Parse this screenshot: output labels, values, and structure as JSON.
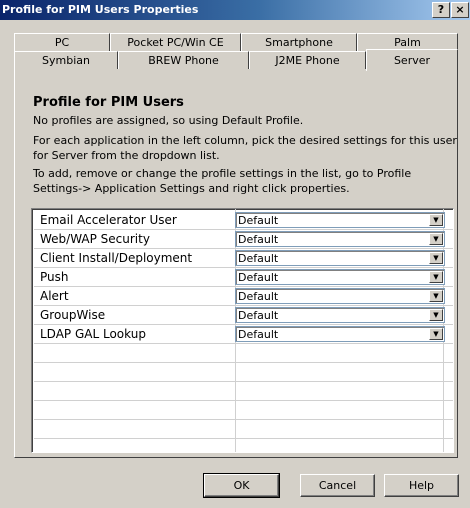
{
  "window": {
    "title": "Profile for PIM Users Properties",
    "help_button": "?",
    "close_button": "×"
  },
  "tabs": {
    "row_back": [
      "PC",
      "Pocket PC/Win CE",
      "Smartphone",
      "Palm"
    ],
    "row_front": [
      "Symbian",
      "BREW Phone",
      "J2ME Phone",
      "Server"
    ],
    "active": "Server"
  },
  "content": {
    "heading": "Profile for PIM Users",
    "line1": "No profiles are assigned, so using Default Profile.",
    "line2": "For each application in the left column, pick the desired settings for this user for Server from the dropdown list.",
    "line3": "To add, remove or change the profile settings in the list, go to Profile Settings-> Application Settings and right click properties."
  },
  "applications": [
    {
      "name": "Email Accelerator User",
      "value": "Default"
    },
    {
      "name": "Web/WAP Security",
      "value": "Default"
    },
    {
      "name": "Client Install/Deployment",
      "value": "Default"
    },
    {
      "name": "Push",
      "value": "Default"
    },
    {
      "name": "Alert",
      "value": "Default"
    },
    {
      "name": "GroupWise",
      "value": "Default"
    },
    {
      "name": "LDAP GAL Lookup",
      "value": "Default"
    }
  ],
  "buttons": {
    "ok": "OK",
    "cancel": "Cancel",
    "help": "Help"
  },
  "colors": {
    "title_start": "#0a246a",
    "title_end": "#a6caf0",
    "face": "#d4d0c8"
  }
}
